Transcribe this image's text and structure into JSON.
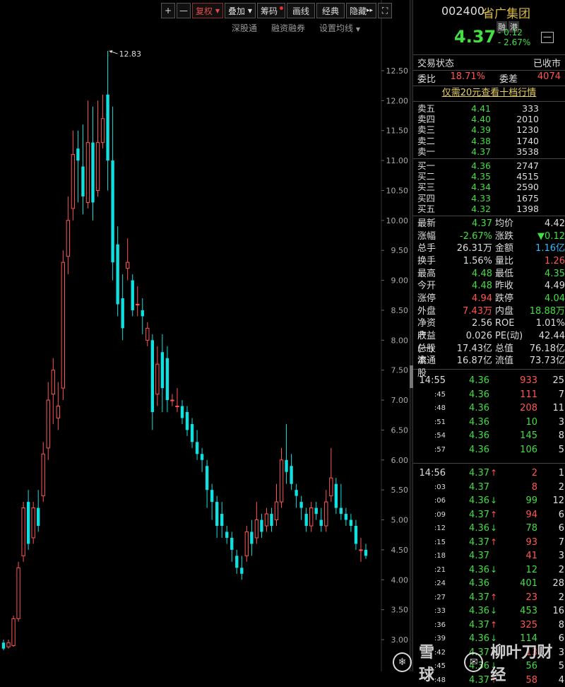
{
  "toolbar": {
    "plus": "+",
    "minus": "—",
    "fuquan": "复权",
    "diejia": "叠加",
    "chouma": "筹码",
    "hualine": "画线",
    "jingdian": "经典",
    "yincang": "隐藏",
    "fullscreen": "⛶"
  },
  "subbar": {
    "shengutong": "深股通",
    "rongzi": "融资融券",
    "junxian": "设置均线"
  },
  "stock": {
    "code": "002400",
    "name": "省广集团",
    "tag1": "融",
    "tag2": "港",
    "price": "4.37",
    "change": "- 0.12",
    "change_pct": "- 2.67%",
    "min_btn": "—"
  },
  "status": {
    "label": "交易状态",
    "value": "已收市"
  },
  "weibi": {
    "label": "委比",
    "value": "18.71%",
    "label2": "委差",
    "value2": "4074"
  },
  "promo": "仅需20元查看十档行情",
  "orderbook": {
    "sells": [
      {
        "label": "卖五",
        "price": "4.41",
        "vol": "333"
      },
      {
        "label": "卖四",
        "price": "4.40",
        "vol": "2010"
      },
      {
        "label": "卖三",
        "price": "4.39",
        "vol": "1230"
      },
      {
        "label": "卖二",
        "price": "4.38",
        "vol": "1740"
      },
      {
        "label": "卖一",
        "price": "4.37",
        "vol": "3538"
      }
    ],
    "buys": [
      {
        "label": "买一",
        "price": "4.36",
        "vol": "2747"
      },
      {
        "label": "买二",
        "price": "4.35",
        "vol": "4515"
      },
      {
        "label": "买三",
        "price": "4.34",
        "vol": "2590"
      },
      {
        "label": "买四",
        "price": "4.33",
        "vol": "1675"
      },
      {
        "label": "买五",
        "price": "4.32",
        "vol": "1398"
      }
    ]
  },
  "stats": [
    {
      "l1": "最新",
      "v1": "4.37",
      "c1": "g",
      "l2": "均价",
      "v2": "4.42",
      "c2": "w"
    },
    {
      "l1": "涨幅",
      "v1": "-2.67%",
      "c1": "g",
      "l2": "涨跌",
      "v2": "▼0.12",
      "c2": "g"
    },
    {
      "l1": "总手",
      "v1": "26.31万",
      "c1": "w",
      "l2": "金额",
      "v2": "1.16亿",
      "c2": "c"
    },
    {
      "l1": "换手",
      "v1": "1.56%",
      "c1": "w",
      "l2": "量比",
      "v2": "1.26",
      "c2": "r"
    },
    {
      "l1": "最高",
      "v1": "4.48",
      "c1": "g",
      "l2": "最低",
      "v2": "4.35",
      "c2": "g"
    },
    {
      "l1": "今开",
      "v1": "4.48",
      "c1": "g",
      "l2": "昨收",
      "v2": "4.49",
      "c2": "w"
    },
    {
      "l1": "涨停",
      "v1": "4.94",
      "c1": "r",
      "l2": "跌停",
      "v2": "4.04",
      "c2": "g"
    },
    {
      "l1": "外盘",
      "v1": "7.43万",
      "c1": "r",
      "l2": "内盘",
      "v2": "18.88万",
      "c2": "g"
    },
    {
      "l1": "净资产",
      "v1": "2.56",
      "c1": "w",
      "l2": "ROE",
      "v2": "1.01%",
      "c2": "w"
    },
    {
      "l1": "收益(一)",
      "v1": "0.026",
      "c1": "w",
      "l2": "PE(动)",
      "v2": "42.44",
      "c2": "w"
    },
    {
      "l1": "总股本",
      "v1": "17.43亿",
      "c1": "w",
      "l2": "总值",
      "v2": "76.18亿",
      "c2": "w"
    },
    {
      "l1": "流通股",
      "v1": "16.87亿",
      "c1": "w",
      "l2": "流值",
      "v2": "73.73亿",
      "c2": "w"
    }
  ],
  "ticks_group1": [
    {
      "t": "14:55",
      "p": "4.36",
      "a": "",
      "v": "933",
      "vc": "r",
      "n": "25"
    },
    {
      "t": ":45",
      "p": "4.36",
      "a": "",
      "v": "111",
      "vc": "r",
      "n": "7"
    },
    {
      "t": ":48",
      "p": "4.36",
      "a": "",
      "v": "208",
      "vc": "r",
      "n": "11"
    },
    {
      "t": ":51",
      "p": "4.36",
      "a": "",
      "v": "10",
      "vc": "g",
      "n": "3"
    },
    {
      "t": ":54",
      "p": "4.36",
      "a": "",
      "v": "145",
      "vc": "g",
      "n": "8"
    },
    {
      "t": ":57",
      "p": "4.36",
      "a": "",
      "v": "106",
      "vc": "g",
      "n": "5"
    }
  ],
  "ticks_group2": [
    {
      "t": "14:56",
      "p": "4.37",
      "a": "↑",
      "ac": "r",
      "v": "2",
      "vc": "r",
      "n": "1"
    },
    {
      "t": ":03",
      "p": "4.37",
      "a": "",
      "v": "8",
      "vc": "r",
      "n": "2"
    },
    {
      "t": ":06",
      "p": "4.36",
      "a": "↓",
      "ac": "g",
      "v": "99",
      "vc": "g",
      "n": "12"
    },
    {
      "t": ":09",
      "p": "4.37",
      "a": "↑",
      "ac": "r",
      "v": "94",
      "vc": "r",
      "n": "6"
    },
    {
      "t": ":12",
      "p": "4.36",
      "a": "↓",
      "ac": "g",
      "v": "78",
      "vc": "g",
      "n": "6"
    },
    {
      "t": ":15",
      "p": "4.37",
      "a": "↑",
      "ac": "r",
      "v": "93",
      "vc": "r",
      "n": "7"
    },
    {
      "t": ":18",
      "p": "4.37",
      "a": "",
      "v": "41",
      "vc": "r",
      "n": "3"
    },
    {
      "t": ":21",
      "p": "4.36",
      "a": "↓",
      "ac": "g",
      "v": "12",
      "vc": "g",
      "n": "2"
    },
    {
      "t": ":24",
      "p": "4.36",
      "a": "",
      "v": "401",
      "vc": "g",
      "n": "28"
    },
    {
      "t": ":27",
      "p": "4.37",
      "a": "↑",
      "ac": "r",
      "v": "23",
      "vc": "r",
      "n": "2"
    },
    {
      "t": ":33",
      "p": "4.36",
      "a": "↓",
      "ac": "g",
      "v": "453",
      "vc": "g",
      "n": "16"
    },
    {
      "t": ":36",
      "p": "4.37",
      "a": "↑",
      "ac": "r",
      "v": "325",
      "vc": "r",
      "n": "8"
    },
    {
      "t": ":39",
      "p": "4.36",
      "a": "↓",
      "ac": "g",
      "v": "114",
      "vc": "g",
      "n": "6"
    },
    {
      "t": ":42",
      "p": "4.37",
      "a": "↑",
      "ac": "r",
      "v": "13",
      "vc": "r",
      "n": "3"
    },
    {
      "t": ":45",
      "p": "4.36",
      "a": "↓",
      "ac": "g",
      "v": "56",
      "vc": "g",
      "n": "5"
    },
    {
      "t": ":48",
      "p": "4.37",
      "a": "↑",
      "ac": "r",
      "v": "58",
      "vc": "r",
      "n": "4"
    }
  ],
  "watermark": {
    "left": "雪球",
    "right": "柳叶刀财经"
  },
  "colors": {
    "up": "#ff5555",
    "down": "#11e0e0",
    "bg": "#000000",
    "grid": "#333333"
  },
  "chart_data": {
    "type": "candlestick",
    "ylim": [
      2.8,
      13.1
    ],
    "yticks": [
      "12.50",
      "12.00",
      "11.50",
      "11.00",
      "10.50",
      "10.00",
      "9.50",
      "9.00",
      "8.50",
      "8.00",
      "7.50",
      "7.00",
      "6.50",
      "6.00",
      "5.50",
      "5.00",
      "4.50",
      "4.00",
      "3.50",
      "3.00"
    ],
    "max_label": "12.83",
    "candles": [
      [
        2.95,
        2.85,
        3.0,
        2.82
      ],
      [
        2.88,
        2.95,
        3.0,
        2.85
      ],
      [
        2.9,
        3.35,
        3.4,
        2.88
      ],
      [
        3.35,
        4.2,
        4.3,
        3.3
      ],
      [
        4.4,
        5.2,
        5.3,
        4.3
      ],
      [
        5.3,
        4.6,
        5.5,
        4.5
      ],
      [
        4.7,
        5.2,
        5.3,
        4.6
      ],
      [
        5.2,
        4.9,
        5.5,
        4.8
      ],
      [
        5.4,
        6.1,
        6.3,
        5.3
      ],
      [
        6.2,
        7.0,
        7.3,
        6.0
      ],
      [
        7.1,
        7.5,
        7.7,
        6.6
      ],
      [
        6.7,
        6.9,
        7.3,
        6.5
      ],
      [
        7.2,
        9.3,
        9.5,
        7.0
      ],
      [
        9.4,
        10.0,
        10.4,
        9.1
      ],
      [
        10.2,
        11.1,
        11.5,
        10.0
      ],
      [
        11.2,
        11.0,
        11.5,
        10.3
      ],
      [
        10.9,
        10.4,
        11.6,
        10.1
      ],
      [
        10.3,
        11.3,
        12.0,
        10.2
      ],
      [
        11.3,
        10.3,
        11.9,
        10.0
      ],
      [
        10.5,
        11.3,
        12.0,
        10.4
      ],
      [
        11.3,
        11.7,
        12.1,
        11.2
      ],
      [
        12.1,
        11.0,
        12.83,
        10.5
      ],
      [
        11.0,
        9.3,
        11.9,
        9.0
      ],
      [
        9.6,
        8.6,
        9.9,
        8.4
      ],
      [
        8.7,
        8.2,
        9.1,
        8.0
      ],
      [
        9.2,
        9.3,
        9.7,
        9.0
      ],
      [
        9.0,
        8.5,
        9.1,
        8.4
      ],
      [
        8.6,
        8.6,
        8.9,
        8.4
      ],
      [
        8.5,
        8.4,
        8.7,
        8.1
      ],
      [
        8.0,
        8.2,
        8.3,
        7.9
      ],
      [
        8.0,
        6.8,
        8.1,
        6.5
      ],
      [
        7.1,
        7.6,
        7.9,
        6.9
      ],
      [
        7.8,
        7.2,
        8.1,
        6.8
      ],
      [
        7.7,
        7.0,
        7.9,
        6.8
      ],
      [
        7.0,
        7.0,
        7.1,
        6.9
      ],
      [
        6.9,
        6.9,
        7.2,
        6.8
      ],
      [
        6.9,
        6.7,
        7.0,
        6.6
      ],
      [
        6.8,
        6.5,
        6.9,
        6.4
      ],
      [
        6.6,
        6.3,
        6.7,
        6.2
      ],
      [
        6.3,
        6.1,
        6.5,
        6.0
      ],
      [
        6.1,
        6.0,
        6.2,
        5.8
      ],
      [
        5.9,
        5.5,
        6.0,
        5.2
      ],
      [
        5.5,
        5.3,
        5.6,
        5.0
      ],
      [
        5.3,
        4.9,
        5.4,
        4.7
      ],
      [
        5.1,
        4.9,
        5.3,
        4.7
      ],
      [
        4.8,
        4.7,
        4.9,
        4.6
      ],
      [
        4.7,
        4.5,
        4.8,
        4.3
      ],
      [
        4.4,
        4.2,
        4.5,
        4.1
      ],
      [
        4.2,
        4.1,
        4.4,
        4.0
      ],
      [
        4.4,
        4.8,
        4.9,
        4.3
      ],
      [
        4.8,
        4.6,
        5.0,
        4.4
      ],
      [
        4.7,
        5.0,
        5.3,
        4.6
      ],
      [
        5.0,
        4.8,
        5.1,
        4.7
      ],
      [
        4.9,
        5.1,
        5.2,
        4.8
      ],
      [
        5.1,
        4.9,
        5.2,
        4.8
      ],
      [
        5.0,
        5.3,
        5.6,
        4.9
      ],
      [
        5.3,
        6.0,
        6.2,
        5.2
      ],
      [
        6.0,
        5.8,
        6.6,
        5.6
      ],
      [
        5.9,
        5.6,
        6.1,
        5.5
      ],
      [
        5.5,
        5.4,
        5.6,
        5.2
      ],
      [
        5.3,
        5.2,
        5.4,
        5.0
      ],
      [
        5.1,
        4.9,
        5.2,
        4.8
      ],
      [
        4.9,
        5.2,
        5.3,
        4.8
      ],
      [
        5.2,
        5.1,
        5.3,
        5.0
      ],
      [
        5.0,
        4.9,
        5.2,
        4.8
      ],
      [
        4.9,
        5.3,
        5.5,
        4.8
      ],
      [
        5.4,
        5.7,
        6.2,
        5.3
      ],
      [
        5.6,
        5.2,
        5.7,
        5.1
      ],
      [
        5.2,
        5.1,
        5.6,
        5.0
      ],
      [
        5.1,
        5.0,
        5.2,
        4.9
      ],
      [
        5.0,
        4.9,
        5.1,
        4.8
      ],
      [
        4.9,
        4.6,
        5.0,
        4.5
      ],
      [
        4.5,
        4.5,
        4.7,
        4.3
      ],
      [
        4.5,
        4.4,
        4.6,
        4.35
      ]
    ]
  }
}
